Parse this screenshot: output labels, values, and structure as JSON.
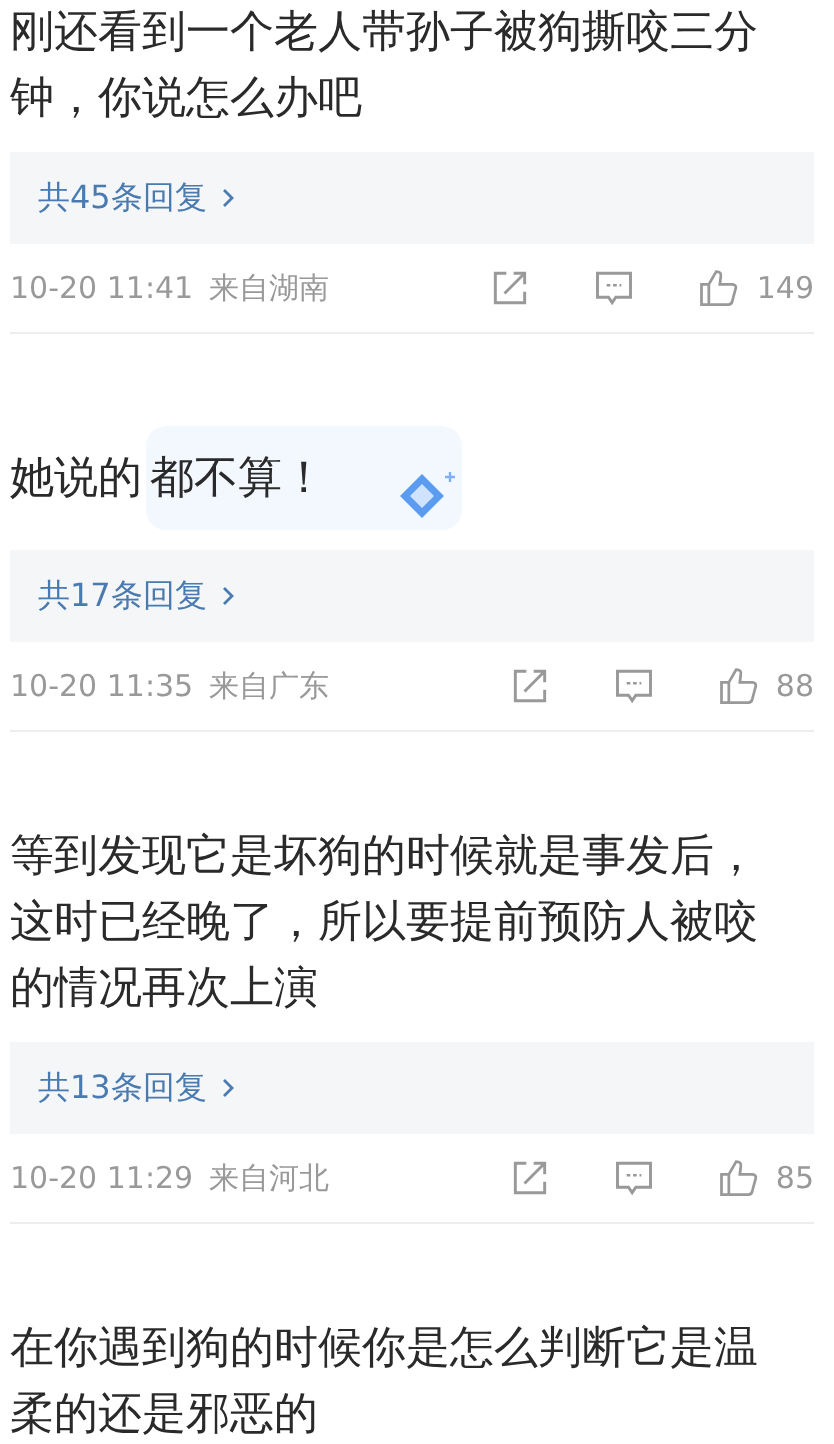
{
  "comments": [
    {
      "text": "刚还看到一个老人带孙子被狗撕咬三分钟，你说怎么办吧",
      "replies": "共45条回复",
      "time": "10-20 11:41",
      "location": "来自湖南",
      "likes": "149"
    },
    {
      "text": "她说的",
      "overlay_text": "都不算！",
      "replies": "共17条回复",
      "time": "10-20 11:35",
      "location": "来自广东",
      "likes": "88"
    },
    {
      "text": "等到发现它是坏狗的时候就是事发后，这时已经晚了，所以要提前预防人被咬的情况再次上演",
      "replies": "共13条回复",
      "time": "10-20 11:29",
      "location": "来自河北",
      "likes": "85"
    },
    {
      "text": "在你遇到狗的时候你是怎么判断它是温柔的还是邪恶的"
    }
  ]
}
